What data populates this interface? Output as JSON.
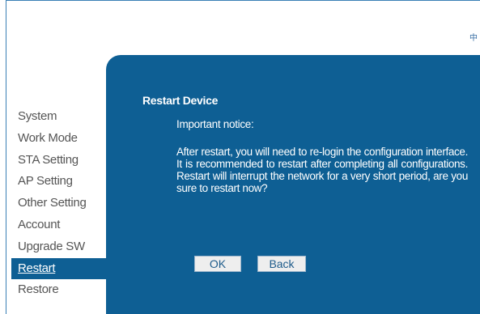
{
  "header": {
    "lang_switch": "中"
  },
  "sidebar": {
    "items": [
      {
        "label": "System"
      },
      {
        "label": "Work Mode"
      },
      {
        "label": "STA Setting"
      },
      {
        "label": "AP Setting"
      },
      {
        "label": "Other Setting"
      },
      {
        "label": "Account"
      },
      {
        "label": "Upgrade SW"
      },
      {
        "label": "Restart"
      },
      {
        "label": "Restore"
      }
    ],
    "active_item": "Restart"
  },
  "panel": {
    "title": "Restart Device",
    "notice_heading": "Important notice:",
    "notice_body": "After restart, you will need to re-login the configuration interface. It is recommended to restart after completing all configurations. Restart will interrupt the network for a very short period, are you sure to restart now?",
    "ok_label": "OK",
    "back_label": "Back"
  },
  "colors": {
    "panel_background": "#0e5f94",
    "frame_border": "#3a7fb5",
    "sidebar_text": "#555555"
  }
}
